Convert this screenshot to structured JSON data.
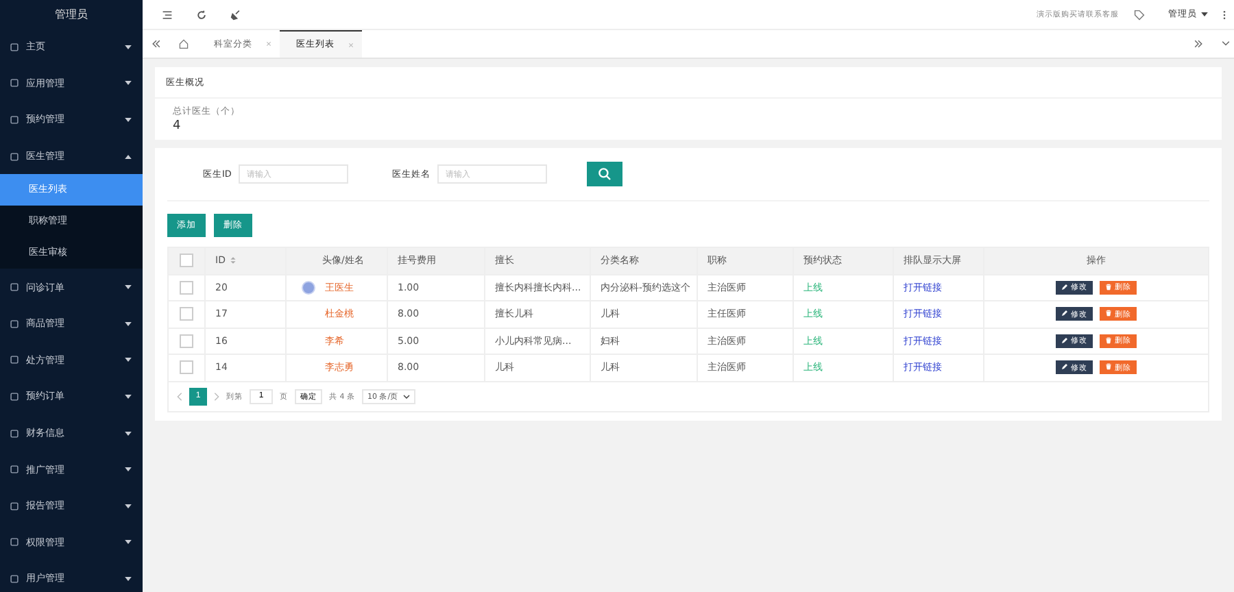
{
  "sidebar": {
    "title": "管理员",
    "items": [
      {
        "label": "主页",
        "expanded": false
      },
      {
        "label": "应用管理",
        "expanded": false
      },
      {
        "label": "预约管理",
        "expanded": false
      },
      {
        "label": "医生管理",
        "expanded": true,
        "children": [
          {
            "label": "医生列表",
            "selected": true
          },
          {
            "label": "职称管理",
            "selected": false
          },
          {
            "label": "医生审核",
            "selected": false
          }
        ]
      },
      {
        "label": "问诊订单",
        "expanded": false
      },
      {
        "label": "商品管理",
        "expanded": false
      },
      {
        "label": "处方管理",
        "expanded": false
      },
      {
        "label": "预约订单",
        "expanded": false
      },
      {
        "label": "财务信息",
        "expanded": false
      },
      {
        "label": "推广管理",
        "expanded": false
      },
      {
        "label": "报告管理",
        "expanded": false
      },
      {
        "label": "权限管理",
        "expanded": false
      },
      {
        "label": "用户管理",
        "expanded": false
      }
    ]
  },
  "topbar": {
    "notice": "演示版购买请联系客服",
    "user": "管理员"
  },
  "tabs": [
    {
      "label": "科室分类",
      "selected": false
    },
    {
      "label": "医生列表",
      "selected": true
    }
  ],
  "overview": {
    "title": "医生概况",
    "stat_label": "总计医生（个）",
    "stat_value": "4"
  },
  "search": {
    "fields": [
      {
        "label": "医生ID",
        "placeholder": "请输入"
      },
      {
        "label": "医生姓名",
        "placeholder": "请输入"
      }
    ]
  },
  "actions": [
    "添加",
    "删除"
  ],
  "table": {
    "select_all_checked": false,
    "columns": [
      "ID",
      "头像/姓名",
      "挂号费用",
      "擅长",
      "分类名称",
      "职称",
      "预约状态",
      "排队显示大屏",
      "操作"
    ],
    "rows": [
      {
        "checked": false,
        "id": "20",
        "avatar": true,
        "name": "王医生",
        "fee": "1.00",
        "specialty": "擅长内科擅长内科...",
        "category": "内分泌科-预约选这个",
        "title": "主治医师",
        "status": "上线",
        "link": "打开链接",
        "edit": "修改",
        "delete": "删除"
      },
      {
        "checked": false,
        "id": "17",
        "avatar": false,
        "name": "杜金桃",
        "fee": "8.00",
        "specialty": "擅长儿科",
        "category": "儿科",
        "title": "主任医师",
        "status": "上线",
        "link": "打开链接",
        "edit": "修改",
        "delete": "删除"
      },
      {
        "checked": false,
        "id": "16",
        "avatar": false,
        "name": "李希",
        "fee": "5.00",
        "specialty": "小儿内科常见病...",
        "category": "妇科",
        "title": "主治医师",
        "status": "上线",
        "link": "打开链接",
        "edit": "修改",
        "delete": "删除"
      },
      {
        "checked": false,
        "id": "14",
        "avatar": false,
        "name": "李志勇",
        "fee": "8.00",
        "specialty": "儿科",
        "category": "儿科",
        "title": "主治医师",
        "status": "上线",
        "link": "打开链接",
        "edit": "修改",
        "delete": "删除"
      }
    ]
  },
  "pagination": {
    "pages": [
      {
        "label": "1",
        "selected": true
      }
    ],
    "goto_label": "到第",
    "goto_value": "1",
    "page_label": "页",
    "confirm": "确定",
    "total": "共 4 条",
    "page_size": "10 条/页"
  }
}
